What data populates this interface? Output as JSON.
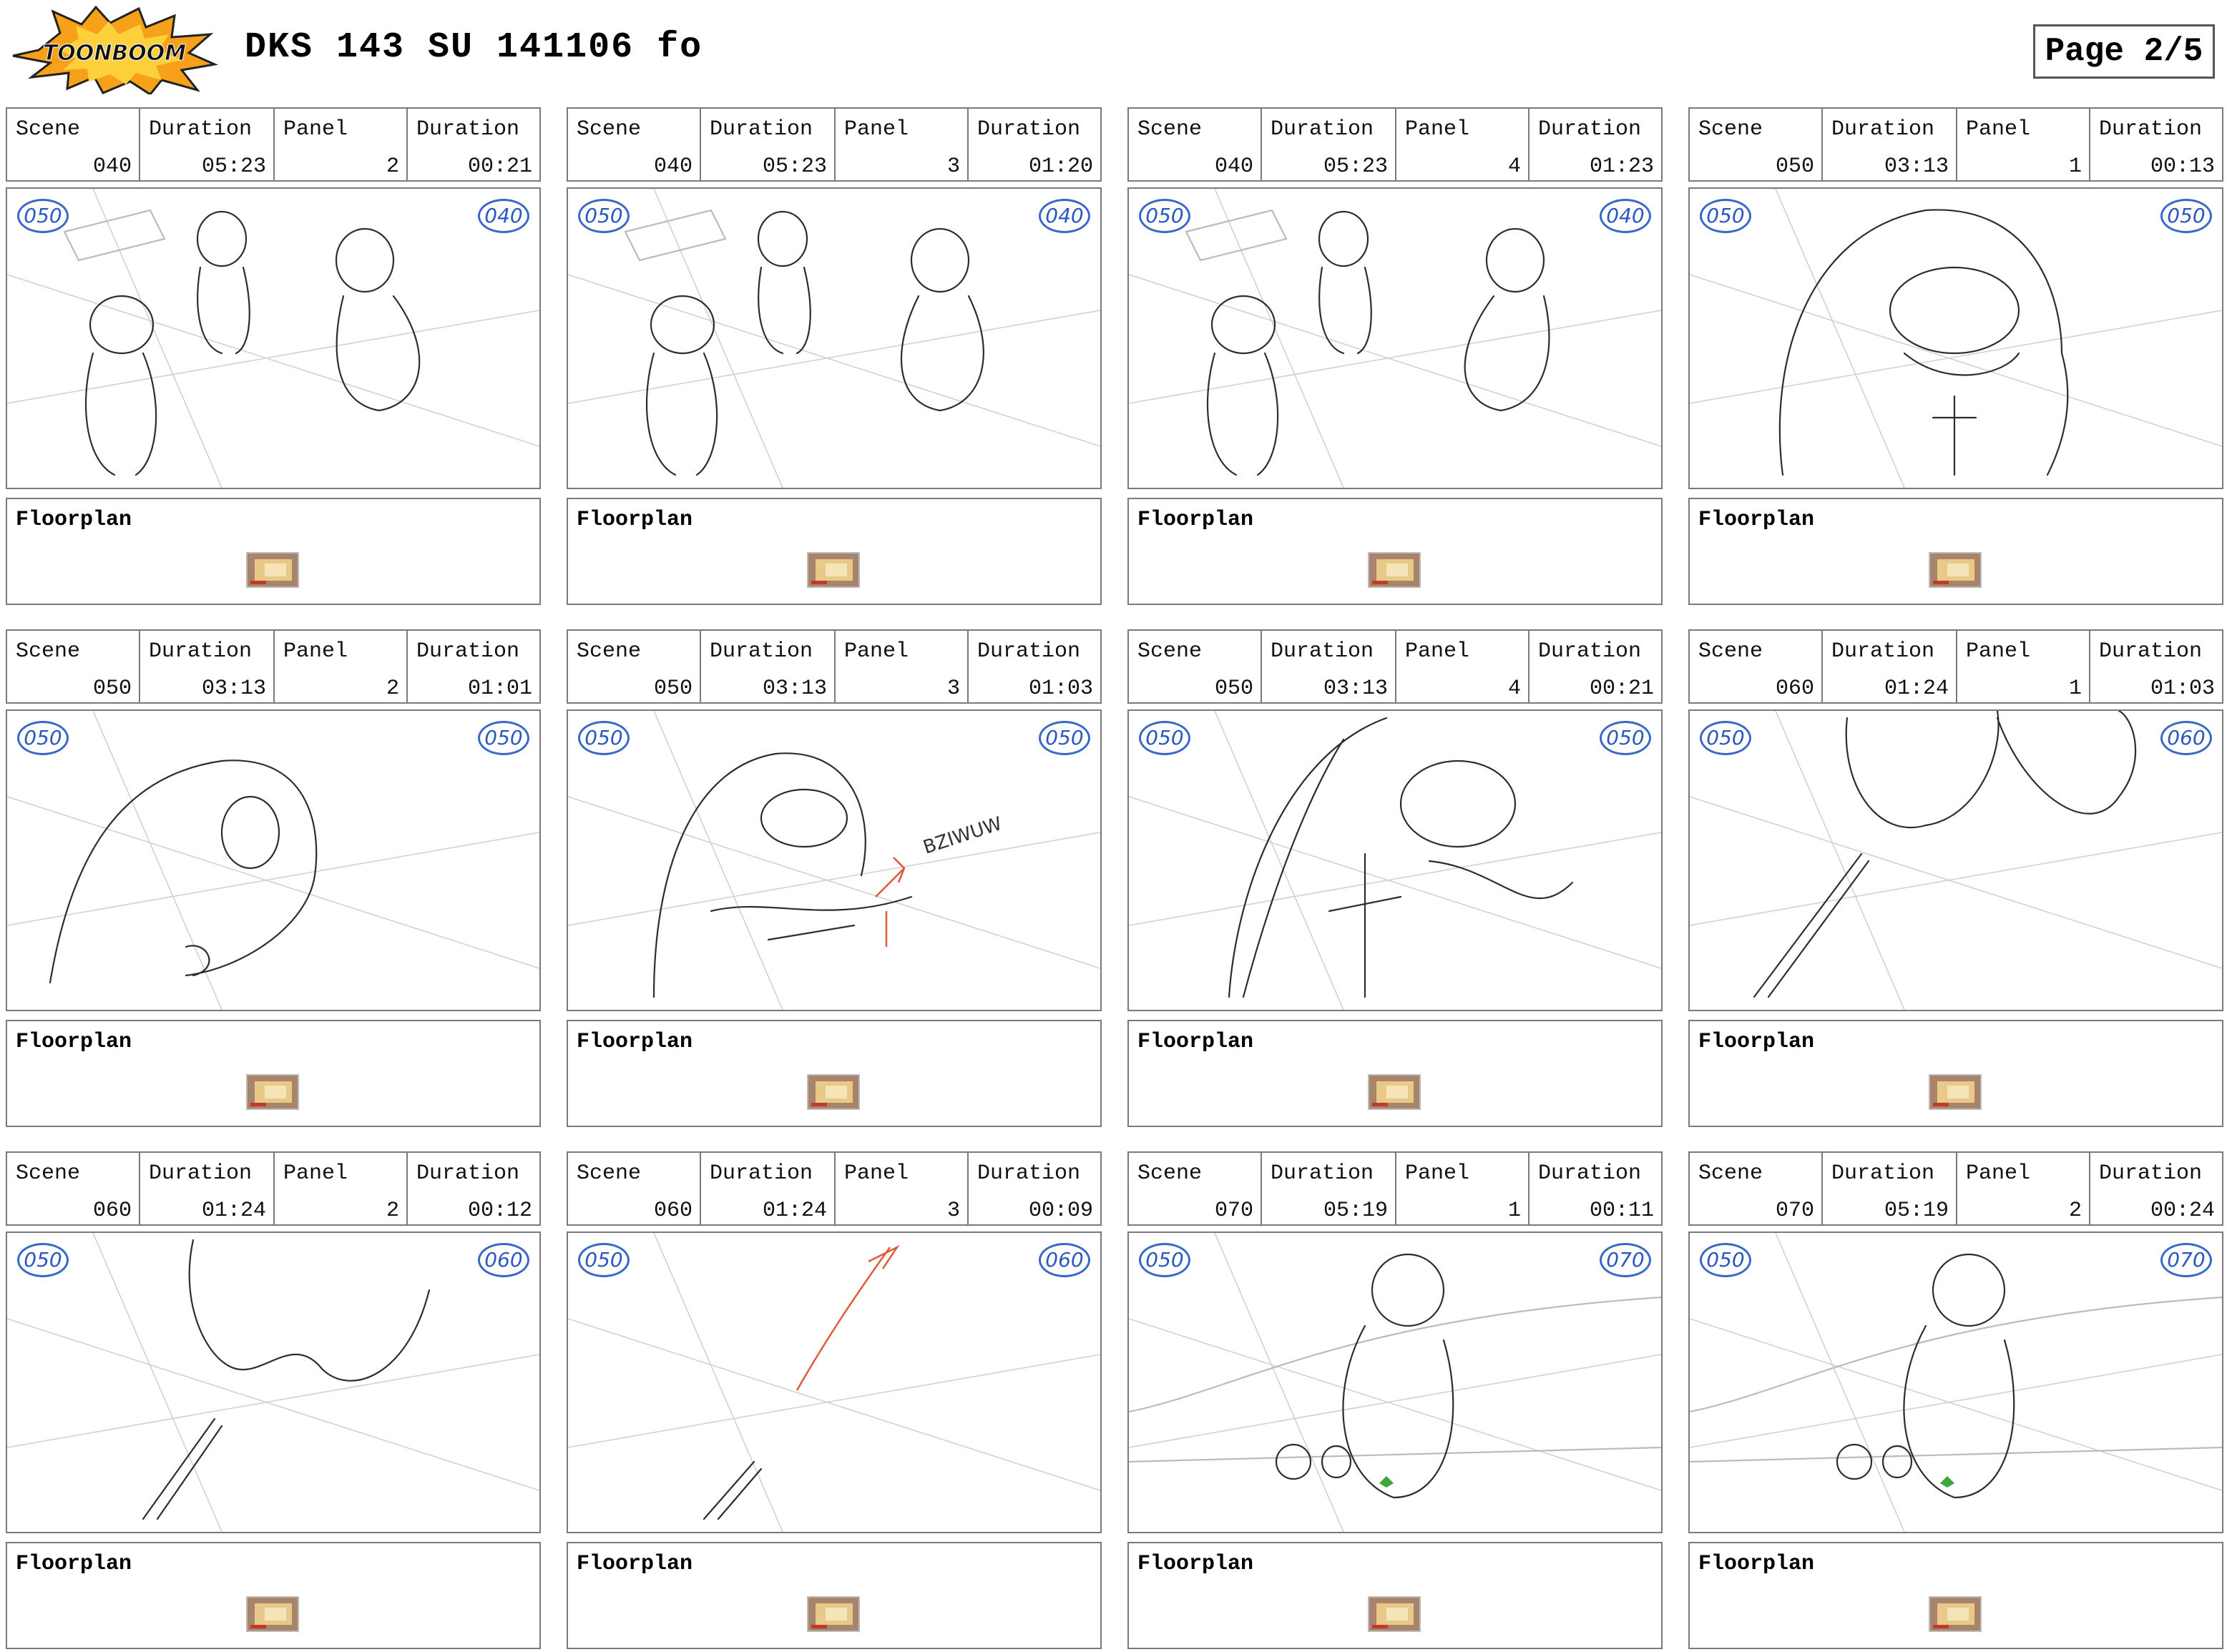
{
  "header": {
    "logo_text": "TOONBOOM",
    "title": "DKS 143 SU 141106 fo",
    "page": "Page 2/5"
  },
  "labels": {
    "scene": "Scene",
    "duration": "Duration",
    "panel": "Panel",
    "floorplan": "Floorplan"
  },
  "panels": [
    {
      "scene": "040",
      "scene_duration": "05:23",
      "panel": "2",
      "panel_duration": "00:21",
      "tag_left": "050",
      "tag_right": "040"
    },
    {
      "scene": "040",
      "scene_duration": "05:23",
      "panel": "3",
      "panel_duration": "01:20",
      "tag_left": "050",
      "tag_right": "040"
    },
    {
      "scene": "040",
      "scene_duration": "05:23",
      "panel": "4",
      "panel_duration": "01:23",
      "tag_left": "050",
      "tag_right": "040"
    },
    {
      "scene": "050",
      "scene_duration": "03:13",
      "panel": "1",
      "panel_duration": "00:13",
      "tag_left": "050",
      "tag_right": "050"
    },
    {
      "scene": "050",
      "scene_duration": "03:13",
      "panel": "2",
      "panel_duration": "01:01",
      "tag_left": "050",
      "tag_right": "050"
    },
    {
      "scene": "050",
      "scene_duration": "03:13",
      "panel": "3",
      "panel_duration": "01:03",
      "tag_left": "050",
      "tag_right": "050",
      "sketch_text": "BZIWUW"
    },
    {
      "scene": "050",
      "scene_duration": "03:13",
      "panel": "4",
      "panel_duration": "00:21",
      "tag_left": "050",
      "tag_right": "050"
    },
    {
      "scene": "060",
      "scene_duration": "01:24",
      "panel": "1",
      "panel_duration": "01:03",
      "tag_left": "050",
      "tag_right": "060"
    },
    {
      "scene": "060",
      "scene_duration": "01:24",
      "panel": "2",
      "panel_duration": "00:12",
      "tag_left": "050",
      "tag_right": "060"
    },
    {
      "scene": "060",
      "scene_duration": "01:24",
      "panel": "3",
      "panel_duration": "00:09",
      "tag_left": "050",
      "tag_right": "060"
    },
    {
      "scene": "070",
      "scene_duration": "05:19",
      "panel": "1",
      "panel_duration": "00:11",
      "tag_left": "050",
      "tag_right": "070"
    },
    {
      "scene": "070",
      "scene_duration": "05:19",
      "panel": "2",
      "panel_duration": "00:24",
      "tag_left": "050",
      "tag_right": "070"
    }
  ],
  "colors": {
    "tag_blue": "#2a58c0",
    "sketch_red": "#e05a3a",
    "sketch_green": "#3aa83a",
    "border": "#7a7a7a"
  }
}
